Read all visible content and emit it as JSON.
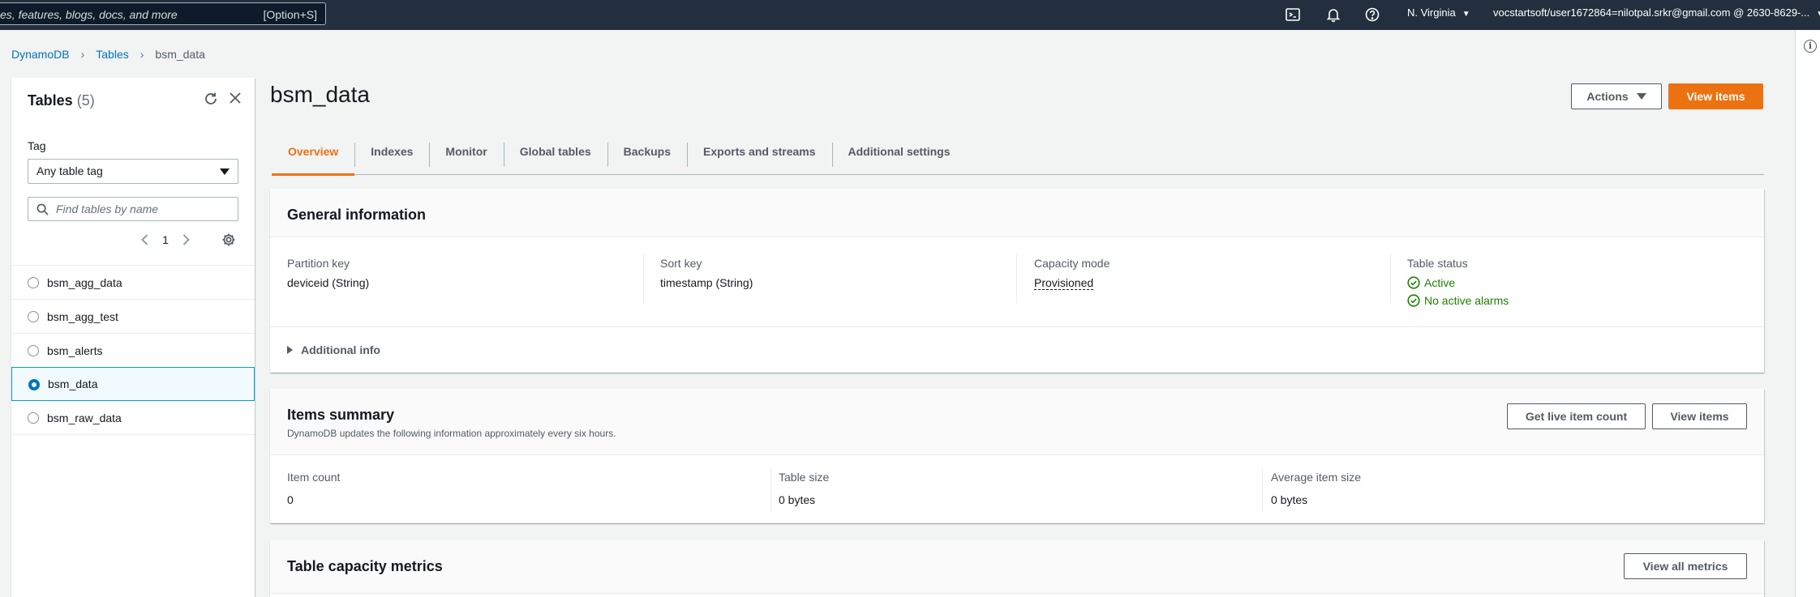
{
  "topnav": {
    "search_placeholder": "es, features, blogs, docs, and more",
    "search_shortcut": "[Option+S]",
    "region": "N. Virginia",
    "account": "vocstartsoft/user1672864=nilotpal.srkr@gmail.com @ 2630-8629-..."
  },
  "breadcrumb": {
    "root": "DynamoDB",
    "section": "Tables",
    "current": "bsm_data"
  },
  "tables_panel": {
    "title": "Tables",
    "count": "(5)",
    "tag_label": "Tag",
    "tag_select": "Any table tag",
    "search_placeholder": "Find tables by name",
    "page": "1",
    "items": [
      {
        "name": "bsm_agg_data",
        "selected": false
      },
      {
        "name": "bsm_agg_test",
        "selected": false
      },
      {
        "name": "bsm_alerts",
        "selected": false
      },
      {
        "name": "bsm_data",
        "selected": true
      },
      {
        "name": "bsm_raw_data",
        "selected": false
      }
    ]
  },
  "main": {
    "title": "bsm_data",
    "actions_label": "Actions",
    "view_items_label": "View items",
    "tabs": [
      {
        "label": "Overview",
        "active": true
      },
      {
        "label": "Indexes",
        "active": false
      },
      {
        "label": "Monitor",
        "active": false
      },
      {
        "label": "Global tables",
        "active": false
      },
      {
        "label": "Backups",
        "active": false
      },
      {
        "label": "Exports and streams",
        "active": false
      },
      {
        "label": "Additional settings",
        "active": false
      }
    ]
  },
  "general_info": {
    "title": "General information",
    "partition_key_label": "Partition key",
    "partition_key_value": "deviceid (String)",
    "sort_key_label": "Sort key",
    "sort_key_value": "timestamp (String)",
    "capacity_mode_label": "Capacity mode",
    "capacity_mode_value": "Provisioned",
    "table_status_label": "Table status",
    "table_status_value": "Active",
    "alarms_value": "No active alarms",
    "additional_info": "Additional info"
  },
  "items_summary": {
    "title": "Items summary",
    "description": "DynamoDB updates the following information approximately every six hours.",
    "live_count_button": "Get live item count",
    "view_items_button": "View items",
    "item_count_label": "Item count",
    "item_count_value": "0",
    "table_size_label": "Table size",
    "table_size_value": "0 bytes",
    "avg_item_size_label": "Average item size",
    "avg_item_size_value": "0 bytes"
  },
  "capacity_metrics": {
    "title": "Table capacity metrics",
    "view_all_button": "View all metrics"
  },
  "colors": {
    "accent": "#ec7211",
    "link": "#0073bb",
    "success": "#1d8102",
    "nav_bg": "#232f3e"
  }
}
